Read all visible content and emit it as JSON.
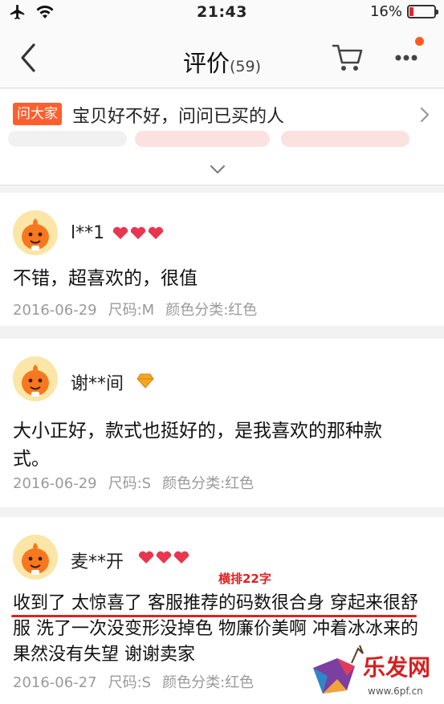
{
  "status_bar": {
    "time": "21:43",
    "battery_percent": "16%",
    "battery_level": 0.16,
    "icons": [
      "airplane-icon",
      "wifi-icon",
      "battery-icon"
    ]
  },
  "nav": {
    "title": "评价",
    "count": "(59)",
    "icons": [
      "back-chevron-icon",
      "cart-icon",
      "more-icon"
    ],
    "accent_color": "#ff5a1f"
  },
  "ask": {
    "tag": "问大家",
    "text": "宝贝好不好，问问已买的人"
  },
  "reviews": [
    {
      "username": "l**1",
      "badge": "heart-badges-icon",
      "text": "不错，超喜欢的，很值",
      "date": "2016-06-29",
      "size": "尺码:M",
      "color": "颜色分类:红色"
    },
    {
      "username": "谢**间",
      "badge": "diamond-badge-icon",
      "text": "大小正好，款式也挺好的，是我喜欢的那种款式。",
      "date": "2016-06-29",
      "size": "尺码:S",
      "color": "颜色分类:红色"
    },
    {
      "username": "麦**开",
      "badge": "heart-badges-icon",
      "annotation": "横排22字",
      "text": "收到了 太惊喜了 客服推荐的码数很合身 穿起来很舒服 洗了一次没变形没掉色 物廉价美啊 冲着冰冰来的 果然没有失望 谢谢卖家",
      "date": "2016-06-27",
      "size": "尺码:S",
      "color": "颜色分类:红色"
    }
  ],
  "watermark": {
    "text": "乐发网",
    "url": "www.6pf.cn"
  }
}
